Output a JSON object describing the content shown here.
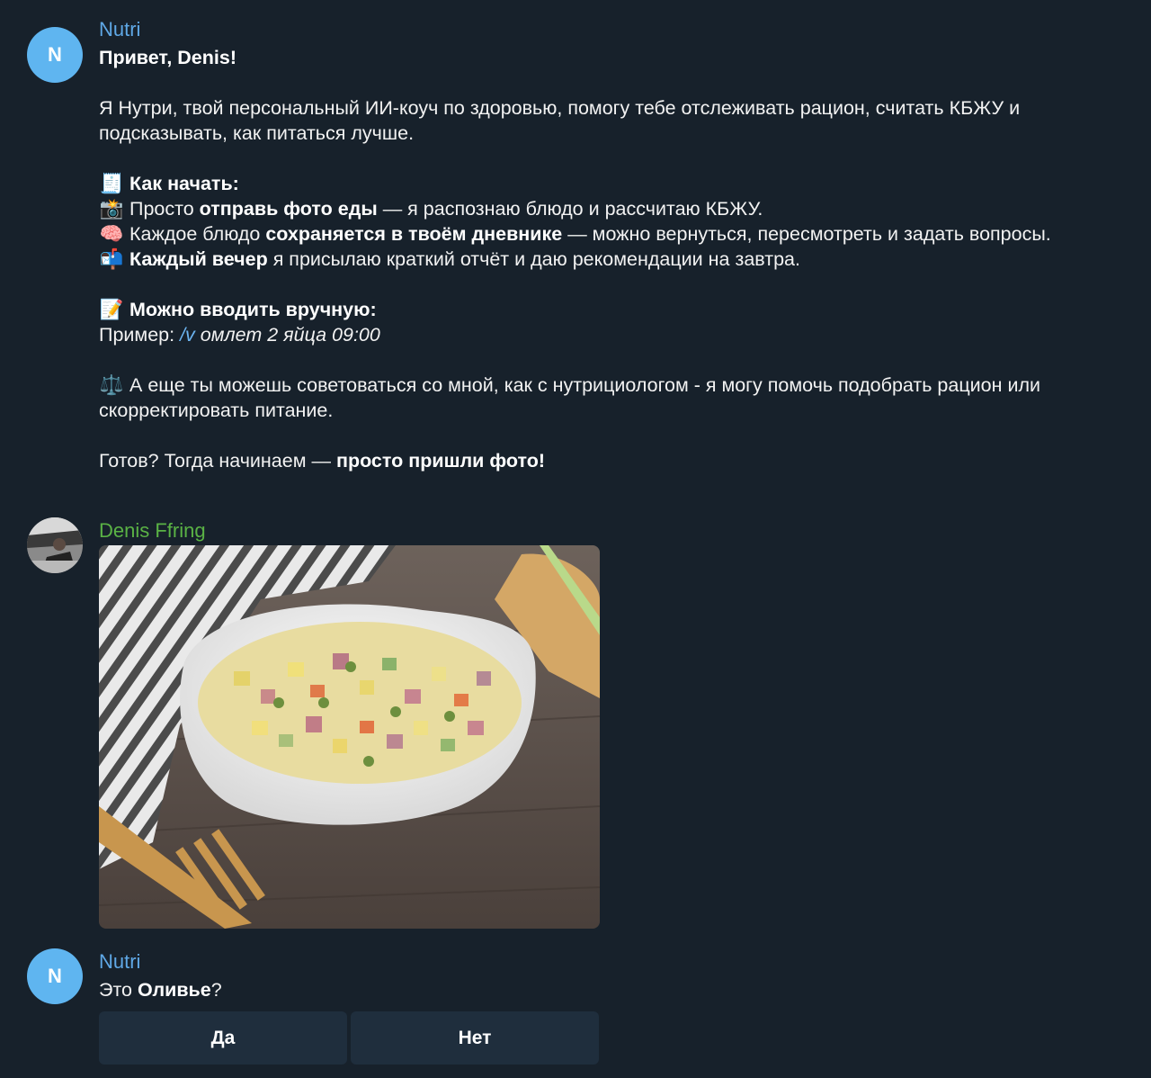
{
  "messages": {
    "welcome": {
      "avatar_letter": "N",
      "sender": "Nutri",
      "greeting": "Привет, Denis!",
      "intro": "Я Нутри, твой персональный ИИ-коуч по здоровью, помогу тебе отслеживать рацион, считать КБЖУ и подсказывать, как питаться лучше.",
      "how_title": "Как начать:",
      "line1_pre": "Просто ",
      "line1_bold": "отправь фото еды",
      "line1_post": " — я распознаю блюдо и рассчитаю КБЖУ.",
      "line2_pre": "Каждое блюдо ",
      "line2_bold": "сохраняется в твоём дневнике",
      "line2_post": " — можно вернуться, пересмотреть и задать вопросы.",
      "line3_bold": "Каждый вечер",
      "line3_post": " я присылаю краткий отчёт и даю рекомендации на завтра.",
      "manual_title": "Можно вводить вручную:",
      "example_label": "Пример: ",
      "example_cmd": "/v",
      "example_text": " омлет 2 яйца 09:00",
      "advice": "А еще ты можешь советоваться со мной, как с нутрициологом - я могу помочь подобрать рацион или скорректировать питание.",
      "ready_pre": "Готов? Тогда начинаем — ",
      "ready_bold": "просто пришли фото!"
    },
    "user_photo": {
      "sender": "Denis Ffring"
    },
    "question": {
      "avatar_letter": "N",
      "sender": "Nutri",
      "text_pre": "Это ",
      "text_bold": "Оливье",
      "text_post": "?"
    }
  },
  "buttons": {
    "yes": "Да",
    "no": "Нет"
  },
  "emoji": {
    "receipt": "🧾",
    "camera": "📸",
    "brain": "🧠",
    "mailbox": "📬",
    "memo": "📝",
    "scales": "⚖️"
  },
  "colors": {
    "background": "#17212b",
    "bot_name": "#5fa8e6",
    "user_name": "#5ab245",
    "avatar": "#5fb5f0",
    "command_link": "#6cb4f0",
    "button_bg": "#1f2e3d"
  }
}
